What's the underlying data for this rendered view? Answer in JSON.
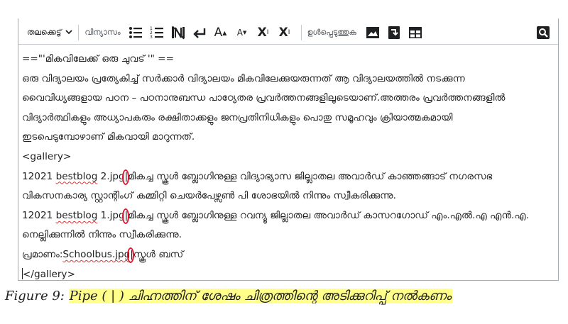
{
  "toolbar": {
    "heading_label": "തലക്കെട്ട്",
    "format_label": "വിന്യാസം",
    "insert_label": "ഉൾപ്പെടുത്തുക",
    "superscript_label": "X",
    "superscript_mark": "I",
    "subscript_label": "X",
    "subscript_mark": "I",
    "big_label": "A",
    "small_label": "A"
  },
  "content": {
    "lines": [
      "==\"'മികവിലേക്ക് ഒരു ചുവട് '\" ==",
      "ഒരു വിദ്യാലയം പ്രത്യേകിച്ച് സർക്കാർ വിദ്യാലയം മികവിലേക്കുയരുന്നത് ആ വിദ്യാലയത്തിൽ നടക്കുന്ന",
      "വൈവിധ്യങ്ങളായ പഠന – പഠനാനുബന്ധ പാഠ്യേതര പ്രവർത്തനങ്ങളിലൂടെയാണ്.അത്തരം പ്രവർത്തനങ്ങളിൽ",
      "വിദ്യാർത്ഥികളും അധ്യാപകരും രക്ഷിതാക്കളും ജനപ്രതിനിധികളും പൊതു സമൂഹവും ക്രിയാത്മകമായി",
      "ഇടപെടുമ്പോഴാണ് മികവായി മാറുന്നത്.",
      "<gallery>"
    ],
    "entry1": {
      "prefix": "12021 ",
      "sq": "bestblog",
      "mid": " 2.jpg",
      "pipe": "|",
      "rest": "മികച്ച സ്കൂൾ ബ്ലോഗിനുള്ള വിദ്യാഭ്യാസ ജില്ലാതല അവാർഡ് കാഞ്ഞങ്ങാട് നഗരസഭ",
      "cont": "വികസനകാര്യ സ്റ്റാന്റിംഗ് കമ്മിറ്റി ചെയർപേഴ്സൺ പി ശോഭയിൽ നിന്നും സ്വീകരിക്കുന്നു."
    },
    "entry2": {
      "prefix": "12021 ",
      "sq": "bestblog",
      "mid": " 1.jpg",
      "pipe": "|",
      "rest": "മികച്ച സ്കൂൾ ബ്ലോഗിനുള്ള റവന്യൂ ജില്ലാതല അവാർഡ് കാസറഗോഡ് എം.എൽ.എ എൻ.എ.",
      "cont": "നെല്ലിക്കുന്നിൽ നിന്നും സ്വീകരിക്കുന്നു."
    },
    "entry3": {
      "prefix": "പ്രമാണം:",
      "sq": "Schoolbus.jpg",
      "pipe": "|",
      "rest": "സ്കൂൾ ബസ്"
    },
    "gallery_close": "/gallery>",
    "gallery_close_lt": "<"
  },
  "caption": {
    "prefix": "Figure 9: ",
    "highlight": "Pipe ( | ) ചിഹ്നത്തിന് ശേഷം ചിത്രത്തിന്റെ അടിക്കുറിപ്പ് നൽകണം"
  },
  "colors": {
    "annotation_ring": "#e0152f",
    "highlight": "#ffff8a"
  }
}
